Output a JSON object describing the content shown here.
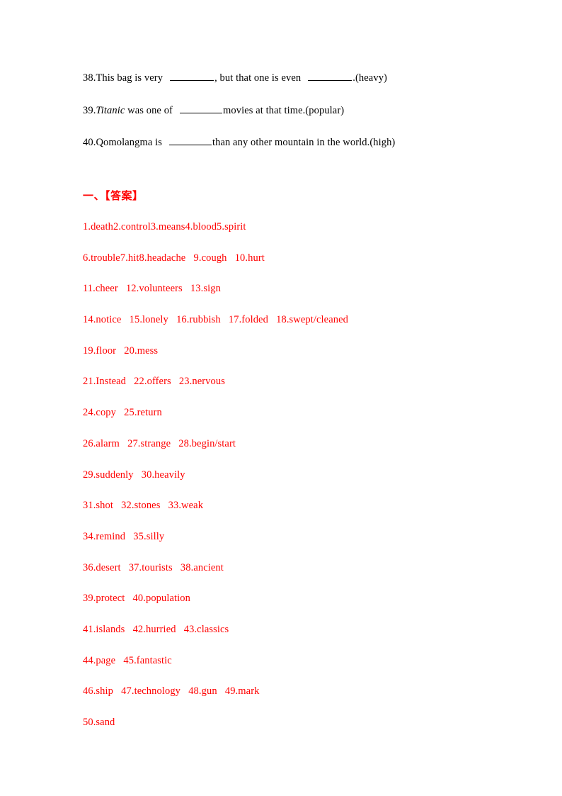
{
  "document": {
    "page_background": "#ffffff",
    "text_color": "#000000",
    "answer_color": "#ff0000"
  },
  "questions": [
    {
      "number": "38.",
      "part1": "This bag is very",
      "part2": ", but that one is even",
      "part3": ".(heavy)",
      "blank1_label": "blank-38-1",
      "blank2_label": "blank-38-2"
    },
    {
      "number": "39.",
      "italic_word": "Titanic",
      "part1": " was one of",
      "part2": "movies at that time.(popular)",
      "blank1_label": "blank-39-1"
    },
    {
      "number": "40.",
      "part1": "Qomolangma is",
      "part2": "than any other mountain in the world.(high)",
      "blank1_label": "blank-40-1"
    }
  ],
  "answers": {
    "heading": "一、【答案】",
    "lines": [
      "1.death2.control3.means4.blood5.spirit",
      "6.trouble7.hit8.headache   9.cough   10.hurt",
      "11.cheer   12.volunteers   13.sign",
      "14.notice   15.lonely   16.rubbish   17.folded   18.swept/cleaned",
      "19.floor   20.mess",
      "21.Instead   22.offers   23.nervous",
      "24.copy   25.return",
      "26.alarm   27.strange   28.begin/start",
      "29.suddenly   30.heavily",
      "31.shot   32.stones   33.weak",
      "34.remind   35.silly",
      "36.desert   37.tourists   38.ancient",
      "39.protect   40.population",
      "41.islands   42.hurried   43.classics",
      "44.page   45.fantastic",
      "46.ship   47.technology   48.gun   49.mark",
      "50.sand"
    ]
  }
}
